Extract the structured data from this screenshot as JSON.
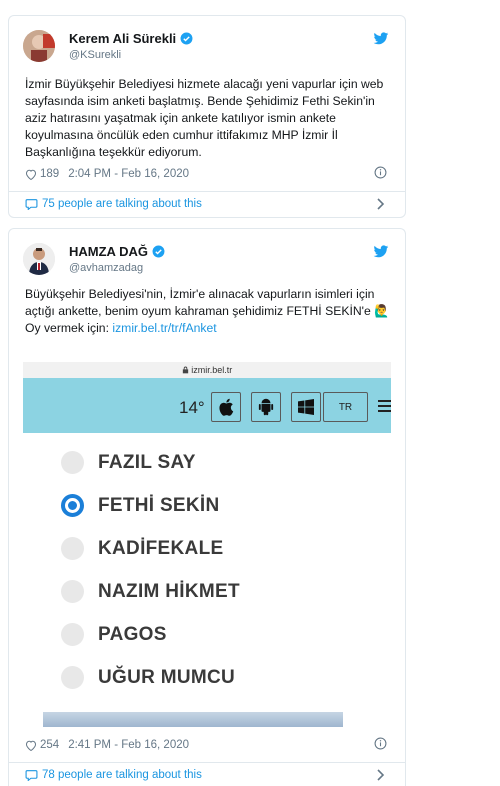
{
  "tweet1": {
    "name": "Kerem Ali Sürekli",
    "handle": "@KSurekli",
    "text": "İzmir Büyükşehir Belediyesi hizmete alacağı yeni vapurlar için web sayfasında isim anketi başlatmış. Bende Şehidimiz Fethi Sekin'in aziz hatırasını yaşatmak için ankete katılıyor ismin ankete koyulmasına öncülük eden cumhur ittifakımız MHP İzmir İl Başkanlığına teşekkür ediyorum.",
    "likes": "189",
    "time": "2:04 PM - Feb 16, 2020",
    "talking": "75 people are talking about this"
  },
  "tweet2": {
    "name": "HAMZA DAĞ",
    "handle": "@avhamzadag",
    "text_line1": "Büyükşehir Belediyesi'nin, İzmir'e alınacak vapurların isimleri için açtığı ankette, benim oyum kahraman şehidimiz FETHİ SEKİN'e",
    "emoji": "🙋‍♂️",
    "vote_prefix": "Oy vermek için:",
    "vote_link": "izmir.bel.tr/tr/fAnket",
    "likes": "254",
    "time": "2:41 PM - Feb 16, 2020",
    "talking": "78 people are talking about this"
  },
  "poll_image": {
    "url": "izmir.bel.tr",
    "temperature": "14°",
    "lang_button": "TR",
    "options": [
      {
        "label": "FAZIL SAY",
        "selected": false
      },
      {
        "label": "FETHİ SEKİN",
        "selected": true
      },
      {
        "label": "KADİFEKALE",
        "selected": false
      },
      {
        "label": "NAZIM HİKMET",
        "selected": false
      },
      {
        "label": "PAGOS",
        "selected": false
      },
      {
        "label": "UĞUR MUMCU",
        "selected": false
      }
    ]
  },
  "icons": {
    "verified": "verified-badge-icon",
    "twitter": "twitter-bird-icon",
    "like": "heart-icon",
    "info": "info-icon",
    "talk": "speech-bubble-icon",
    "chevron": "chevron-right-icon"
  },
  "colors": {
    "accent": "#1b95e0",
    "border": "#e1e8ed",
    "muted": "#657786",
    "site_band": "#8cd3e2",
    "radio_selected": "#1b7fd8"
  }
}
